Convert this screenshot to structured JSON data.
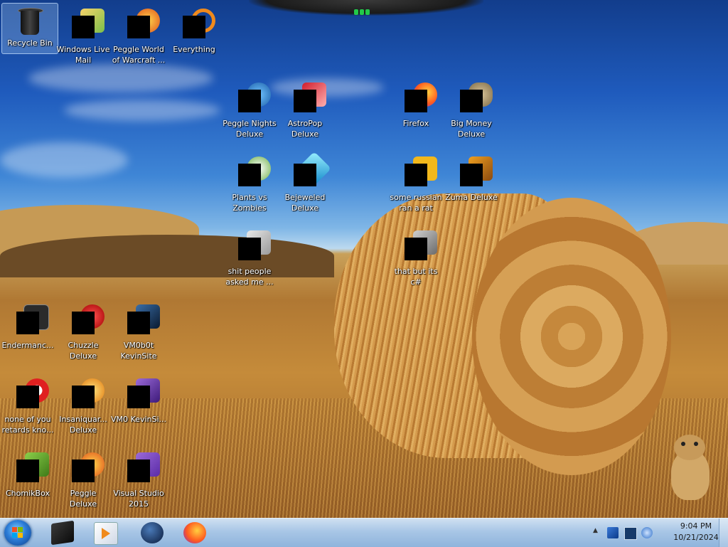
{
  "desktop": {
    "icons": [
      {
        "label": "Recycle Bin"
      },
      {
        "label": "Windows Live Mail"
      },
      {
        "label": "Peggle World of Warcraft ..."
      },
      {
        "label": "Everything"
      },
      {
        "label": "Peggle Nights Deluxe"
      },
      {
        "label": "AstroPop Deluxe"
      },
      {
        "label": "Firefox"
      },
      {
        "label": "Big Money Deluxe"
      },
      {
        "label": "Plants vs Zombies"
      },
      {
        "label": "Bejeweled Deluxe"
      },
      {
        "label": "some russian ran a rat"
      },
      {
        "label": "Zuma Deluxe"
      },
      {
        "label": "shit people asked me ..."
      },
      {
        "label": "that but its c#"
      },
      {
        "label": "Endermanc..."
      },
      {
        "label": "Chuzzle Deluxe"
      },
      {
        "label": "VM0b0t KevinSite"
      },
      {
        "label": "none of you retards kno..."
      },
      {
        "label": "Insaniquar... Deluxe"
      },
      {
        "label": "VM0 KevinSi..."
      },
      {
        "label": "ChomikBox"
      },
      {
        "label": "Peggle Deluxe"
      },
      {
        "label": "Visual Studio 2015"
      }
    ]
  },
  "taskbar": {
    "clock": {
      "time": "9:04 PM",
      "date": "10/21/2024"
    },
    "tray_expand": "▲",
    "pinned": [
      {
        "icon": "media-center-icon"
      },
      {
        "icon": "windows-media-player-icon"
      },
      {
        "icon": "world-globe-icon"
      },
      {
        "icon": "firefox-icon"
      }
    ]
  },
  "colors": {
    "taskbar": "#a8c6e6",
    "sky": "#1f5bbd",
    "field": "#c58b3a"
  }
}
